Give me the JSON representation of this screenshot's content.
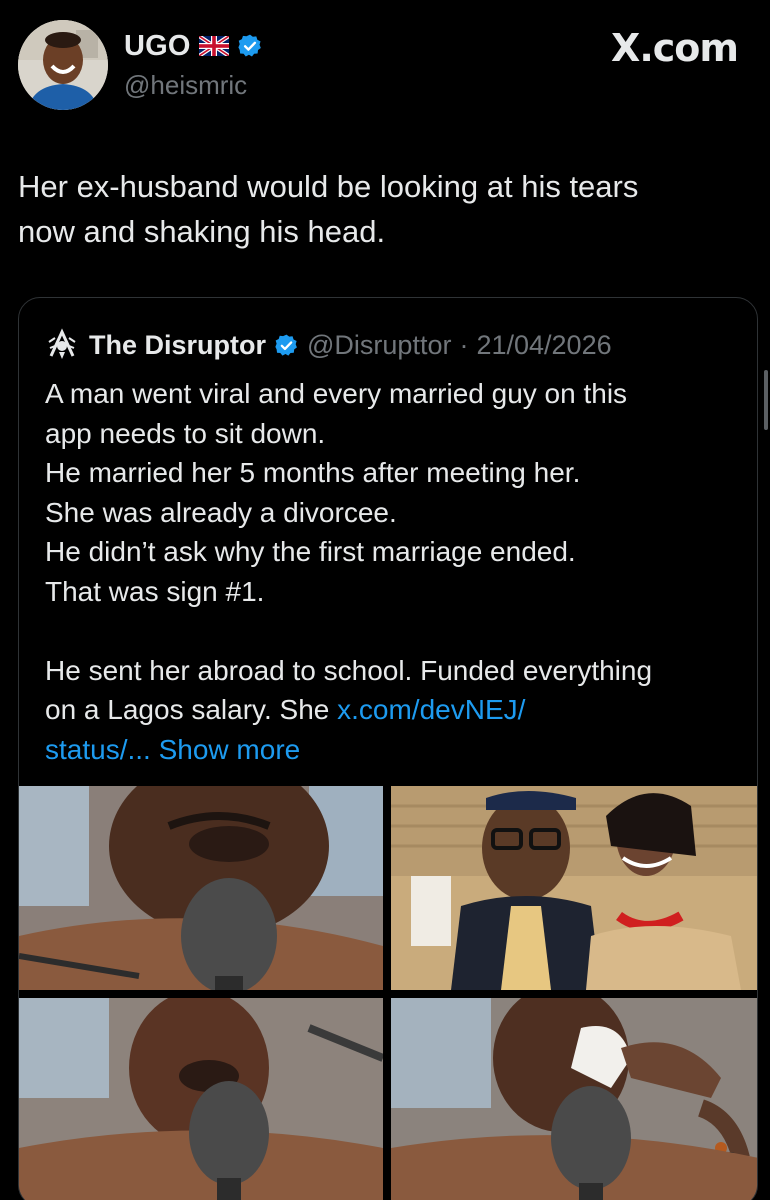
{
  "tweet": {
    "author": {
      "display_name": "UGO",
      "flag_icon": "uk-flag-icon",
      "verified_icon": "verified-badge-icon",
      "handle": "@heismric"
    },
    "brand": "X.com",
    "text_lines": [
      "Her ex-husband would be looking at his tears",
      "now and shaking his head."
    ]
  },
  "quoted_tweet": {
    "author": {
      "display_name": "The Disruptor",
      "handle": "@Disrupttor",
      "separator": "·",
      "date": "21/04/2026"
    },
    "text_lines": [
      "A man went viral and every married guy on this",
      "app needs to sit down.",
      "He married her 5 months after meeting her.",
      "She was already a divorcee.",
      "He didn’t ask why the first marriage ended.",
      "That was sign #1.",
      "",
      "He sent her abroad to school. Funded everything"
    ],
    "last_line_prefix": "on a Lagos salary. She ",
    "link_text_1": "x.com/devNEJ/",
    "link_text_2": "status/...",
    "show_more": "Show more",
    "media": [
      {
        "label": "photo-crying-man-microphone-1",
        "icon": "photo-icon"
      },
      {
        "label": "photo-couple-traditional-attire",
        "icon": "photo-icon"
      },
      {
        "label": "photo-crying-man-microphone-2",
        "icon": "photo-icon"
      },
      {
        "label": "photo-man-wiping-tears-microphone",
        "icon": "photo-icon"
      }
    ]
  },
  "colors": {
    "background": "#000000",
    "text": "#e7e9ea",
    "secondary_text": "#71767b",
    "link": "#1d9bf0",
    "verified": "#1d9bf0",
    "border": "#2f3336"
  }
}
